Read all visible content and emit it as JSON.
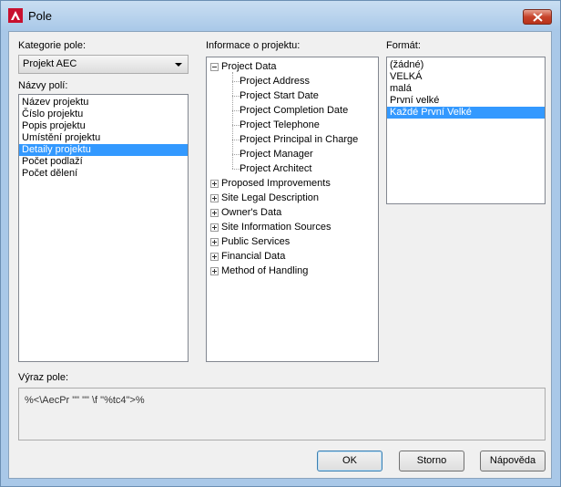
{
  "window": {
    "title": "Pole"
  },
  "category": {
    "label": "Kategorie pole:",
    "value": "Projekt AEC"
  },
  "field_names": {
    "label": "Názvy polí:",
    "items": [
      "Název projektu",
      "Číslo projektu",
      "Popis projektu",
      "Umístění projektu",
      "Detaily projektu",
      "Počet podlaží",
      "Počet dělení"
    ],
    "selected": "Detaily projektu"
  },
  "project_info": {
    "label": "Informace o projektu:",
    "root": "Project Data",
    "children": [
      "Project Address",
      "Project Start Date",
      "Project Completion Date",
      "Project Telephone",
      "Project Principal in Charge",
      "Project Manager",
      "Project Architect"
    ],
    "groups": [
      "Proposed Improvements",
      "Site Legal Description",
      "Owner's Data",
      "Site Information Sources",
      "Public Services",
      "Financial Data",
      "Method of Handling"
    ]
  },
  "format": {
    "label": "Formát:",
    "items": [
      "(žádné)",
      "VELKÁ",
      "malá",
      "První velké",
      "Každé První Velké"
    ],
    "selected": "Každé První Velké"
  },
  "expression": {
    "label": "Výraz pole:",
    "value": "%<\\AecPr \"\" \"\" \\f \"%tc4\">%"
  },
  "buttons": {
    "ok": "OK",
    "cancel": "Storno",
    "help": "Nápověda"
  }
}
